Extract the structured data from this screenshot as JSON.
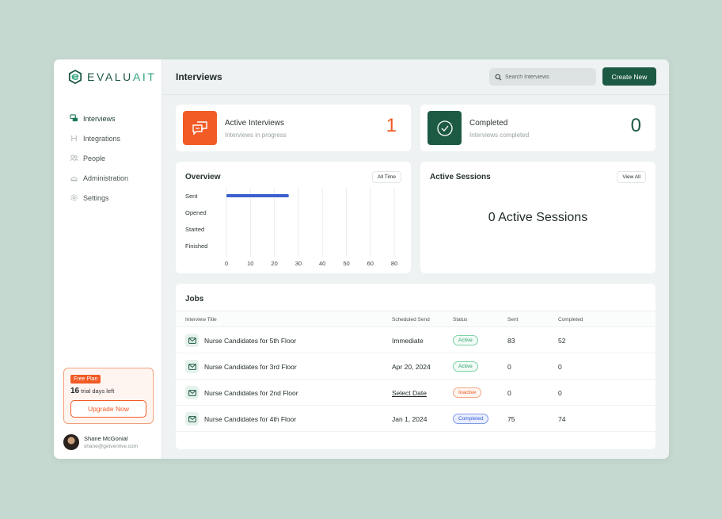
{
  "brand": {
    "name_main": "EVALU",
    "name_accent": "AIT",
    "color": "#1e5a45",
    "accent": "#2fa37c"
  },
  "sidebar": {
    "items": [
      {
        "label": "Interviews",
        "icon": "chat-icon"
      },
      {
        "label": "Integrations",
        "icon": "integrations-icon"
      },
      {
        "label": "People",
        "icon": "people-icon"
      },
      {
        "label": "Administration",
        "icon": "admin-icon"
      },
      {
        "label": "Settings",
        "icon": "gear-icon"
      }
    ],
    "plan": {
      "badge": "Free Plan",
      "days": "16",
      "days_text": " trial days left",
      "upgrade_label": "Upgrade Now"
    },
    "user": {
      "name": "Shane McGonial",
      "email": "shane@getventive.com"
    }
  },
  "header": {
    "title": "Interviews",
    "search_placeholder": "Search Interviews",
    "create_label": "Create New"
  },
  "stats": {
    "active": {
      "title": "Active Interviews",
      "subtitle": "Interviews in progress",
      "value": "1",
      "color": "#f25a26"
    },
    "completed": {
      "title": "Completed",
      "subtitle": "Interviews completed",
      "value": "0",
      "color": "#1d5a44"
    }
  },
  "overview": {
    "title": "Overview",
    "filter_label": "All Time"
  },
  "sessions": {
    "title": "Active Sessions",
    "view_label": "View All",
    "message": "0 Active Sessions"
  },
  "chart_data": {
    "type": "bar",
    "orientation": "horizontal",
    "categories": [
      "Sent",
      "Opened",
      "Started",
      "Finished"
    ],
    "values": [
      26,
      0,
      0,
      0
    ],
    "xticks": [
      "0",
      "10",
      "20",
      "30",
      "40",
      "50",
      "60",
      "80"
    ],
    "xlim": [
      0,
      80
    ],
    "grid": true,
    "bar_color": "#3a5fcf"
  },
  "jobs": {
    "title": "Jobs",
    "columns": [
      "Interview Title",
      "Scheduled Send",
      "Status",
      "Sent",
      "Completed"
    ],
    "rows": [
      {
        "title": "Nurse Candidates for 5th Floor",
        "scheduled": "Immediate",
        "status": "Active",
        "status_kind": "active",
        "sent": "83",
        "completed": "52"
      },
      {
        "title": "Nurse Candidates for 3rd Floor",
        "scheduled": "Apr 20, 2024",
        "status": "Active",
        "status_kind": "active",
        "sent": "0",
        "completed": "0"
      },
      {
        "title": "Nurse Candidates for 2nd Floor",
        "scheduled": "Select Date",
        "status": "Inactive",
        "status_kind": "inactive",
        "sent": "0",
        "completed": "0"
      },
      {
        "title": "Nurse Candidates for 4th Floor",
        "scheduled": "Jan 1, 2024",
        "status": "Completed",
        "status_kind": "completed",
        "sent": "75",
        "completed": "74"
      }
    ]
  }
}
